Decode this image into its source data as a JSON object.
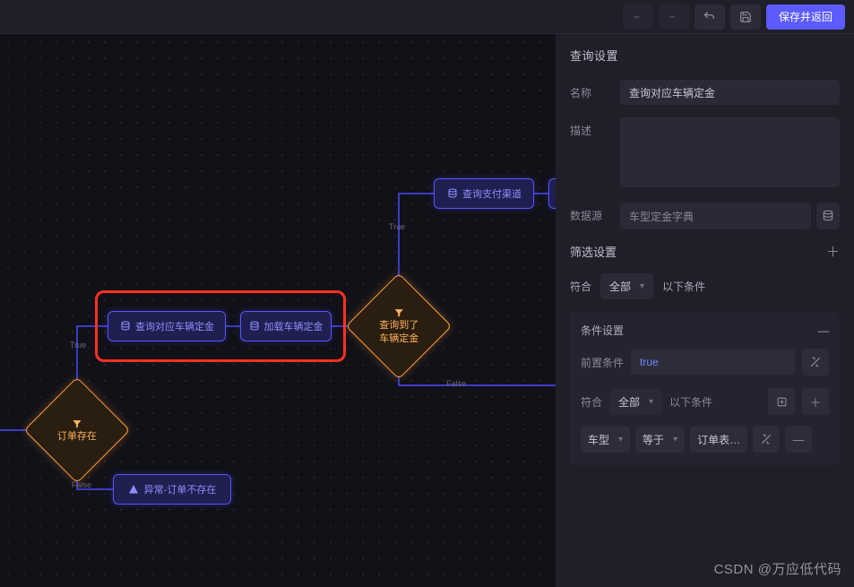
{
  "toolbar": {
    "save_label": "保存并返回"
  },
  "canvas": {
    "edge_labels": {
      "true": "True",
      "false": "False"
    },
    "nodes": {
      "order_exists": {
        "label": "订单存在"
      },
      "query_deposit": {
        "label": "查询对应车辆定金"
      },
      "load_deposit": {
        "label": "加载车辆定金"
      },
      "got_deposit": {
        "line1": "查询到了",
        "line2": "车辆定金"
      },
      "query_channel": {
        "label": "查询支付渠道"
      },
      "ex_no_order": {
        "label": "异常-订单不存在"
      }
    }
  },
  "panel": {
    "title": "查询设置",
    "groups": {
      "name": {
        "label": "名称",
        "value": "查询对应车辆定金"
      },
      "desc": {
        "label": "描述",
        "value": ""
      },
      "source": {
        "label": "数据源",
        "value": "车型定金字典"
      }
    },
    "filter": {
      "title": "筛选设置",
      "match_label": "符合",
      "match_all": "全部",
      "suffix": "以下条件"
    },
    "condition": {
      "title": "条件设置",
      "pre_label": "前置条件",
      "pre_value": "true",
      "match_label": "符合",
      "match_all": "全部",
      "suffix": "以下条件",
      "chips": {
        "field": "车型",
        "op": "等于",
        "value": "订单表…"
      }
    }
  },
  "watermark": "CSDN @万应低代码"
}
